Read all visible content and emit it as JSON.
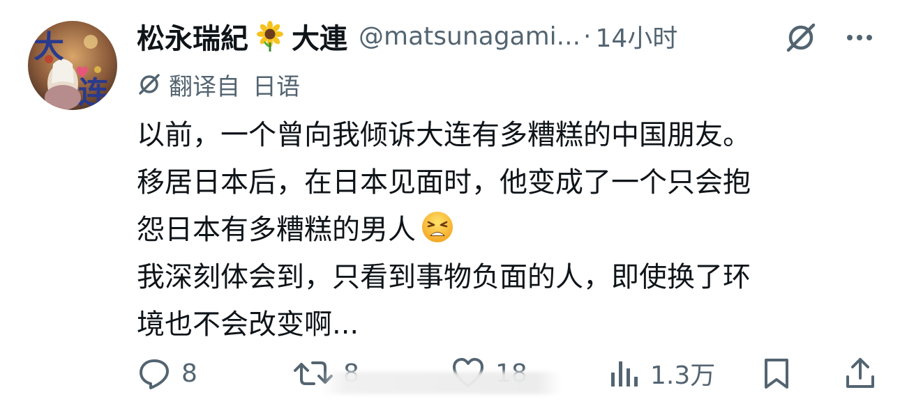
{
  "author": {
    "display_name": "松永瑞紀",
    "display_name_suffix": "大連",
    "handle": "@matsunagami...",
    "separator": "·",
    "time": "14小时"
  },
  "translation": {
    "label": "翻译自",
    "language": "日语"
  },
  "tweet": {
    "lines": [
      "以前，一个曾向我倾诉大连有多糟糕的中国朋友。",
      "移居日本后，在日本见面时，他变成了一个只会抱",
      "怨日本有多糟糕的男人",
      "我深刻体会到，只看到事物负面的人，即使换了环",
      "境也不会改变啊..."
    ]
  },
  "actions": {
    "reply_count": "8",
    "retweet_count": "8",
    "like_count": "18",
    "views_count": "1.3万"
  },
  "icons": {
    "avatar": "avatar-image",
    "sunflower": "sunflower-emoji",
    "grok": "grok-icon",
    "more": "more-icon",
    "translate": "translate-icon",
    "weary_face": "weary-face-emoji",
    "reply": "reply-icon",
    "retweet": "retweet-icon",
    "like": "heart-icon",
    "views": "views-icon",
    "bookmark": "bookmark-icon",
    "share": "share-icon"
  },
  "colors": {
    "text": "#0f1419",
    "secondary": "#536471"
  }
}
